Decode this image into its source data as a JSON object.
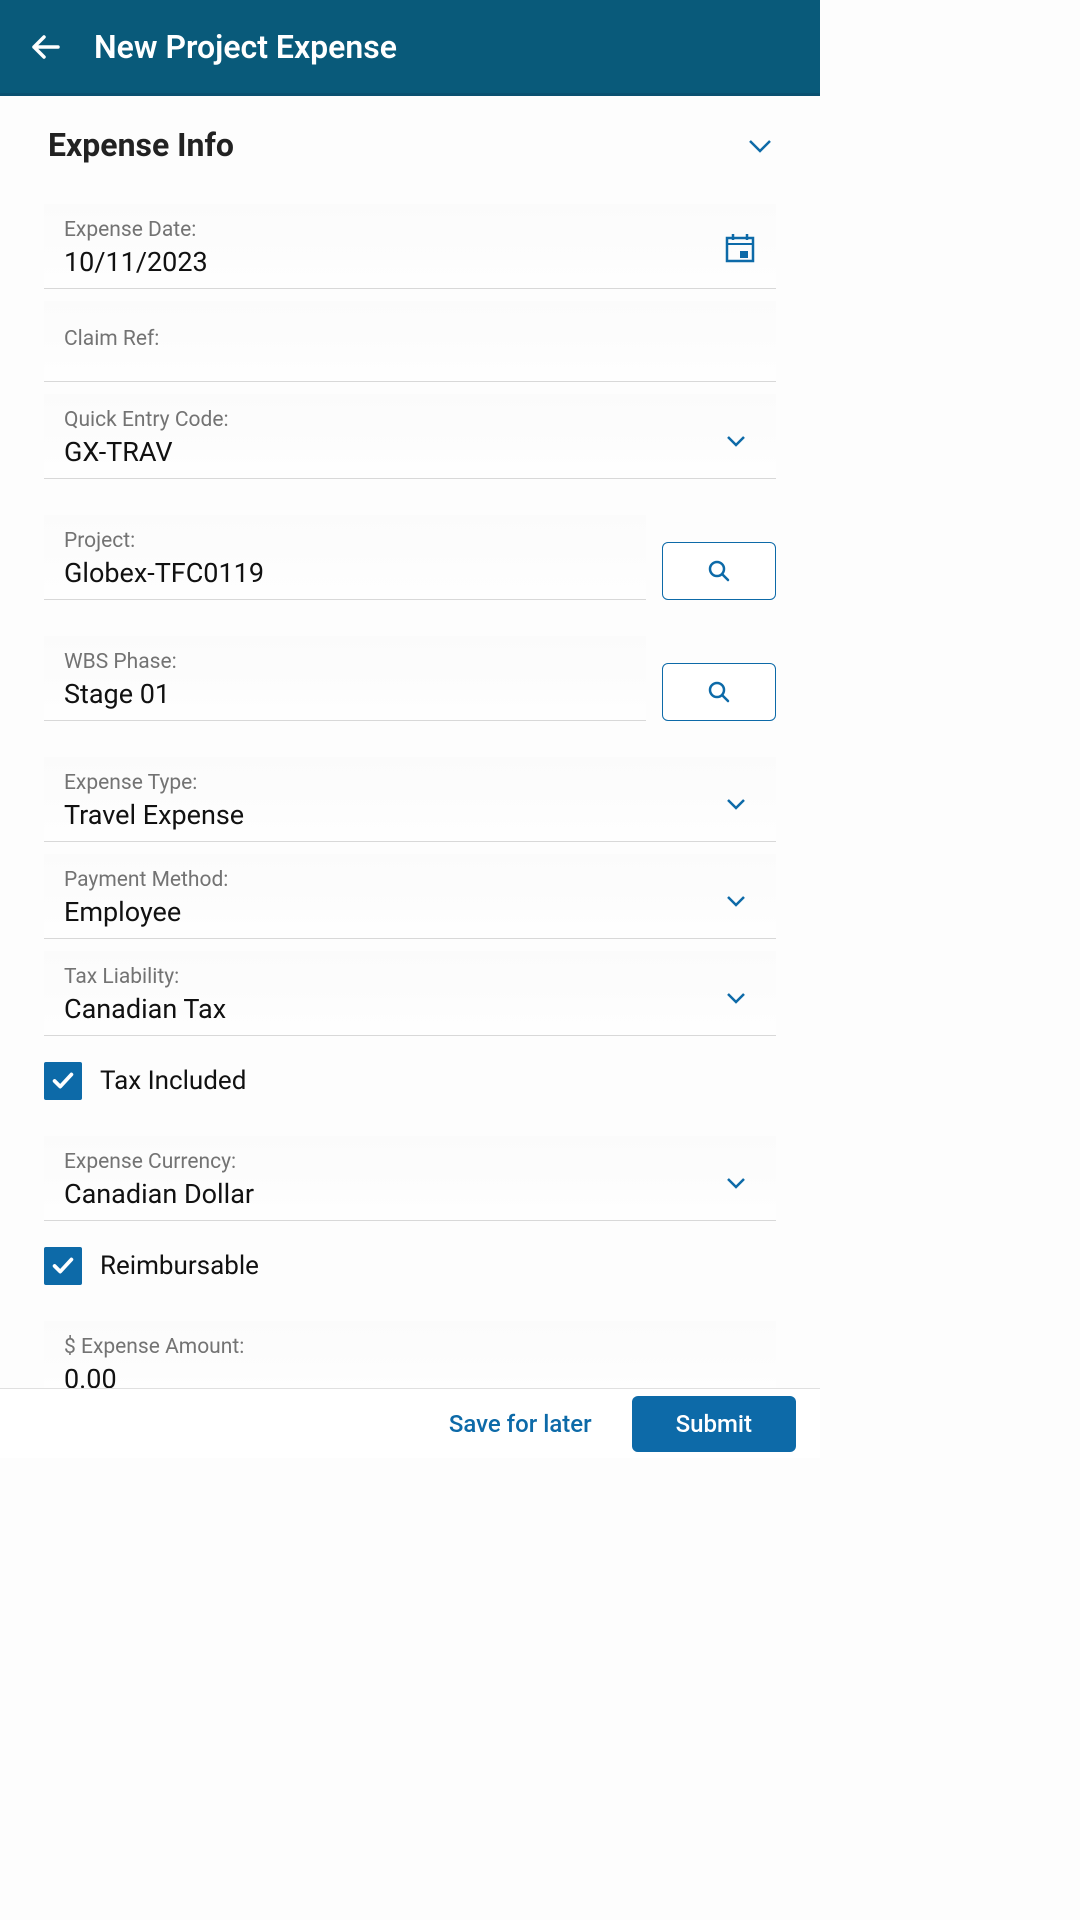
{
  "header": {
    "title": "New Project Expense"
  },
  "section": {
    "title": "Expense Info"
  },
  "fields": {
    "expense_date": {
      "label": "Expense Date:",
      "value": "10/11/2023"
    },
    "claim_ref": {
      "label": "Claim Ref:",
      "value": ""
    },
    "quick_entry": {
      "label": "Quick Entry Code:",
      "value": "GX-TRAV"
    },
    "project": {
      "label": "Project:",
      "value": "Globex-TFC0119"
    },
    "wbs_phase": {
      "label": "WBS Phase:",
      "value": "Stage 01"
    },
    "expense_type": {
      "label": "Expense Type:",
      "value": "Travel Expense"
    },
    "payment_method": {
      "label": "Payment Method:",
      "value": "Employee"
    },
    "tax_liability": {
      "label": "Tax Liability:",
      "value": "Canadian Tax"
    },
    "tax_included": {
      "label": "Tax Included",
      "checked": true
    },
    "expense_currency": {
      "label": "Expense Currency:",
      "value": "Canadian Dollar"
    },
    "reimbursable": {
      "label": "Reimbursable",
      "checked": true
    },
    "expense_amount": {
      "label": "$ Expense Amount:",
      "value": "0.00"
    }
  },
  "footer": {
    "save_label": "Save for later",
    "submit_label": "Submit"
  }
}
